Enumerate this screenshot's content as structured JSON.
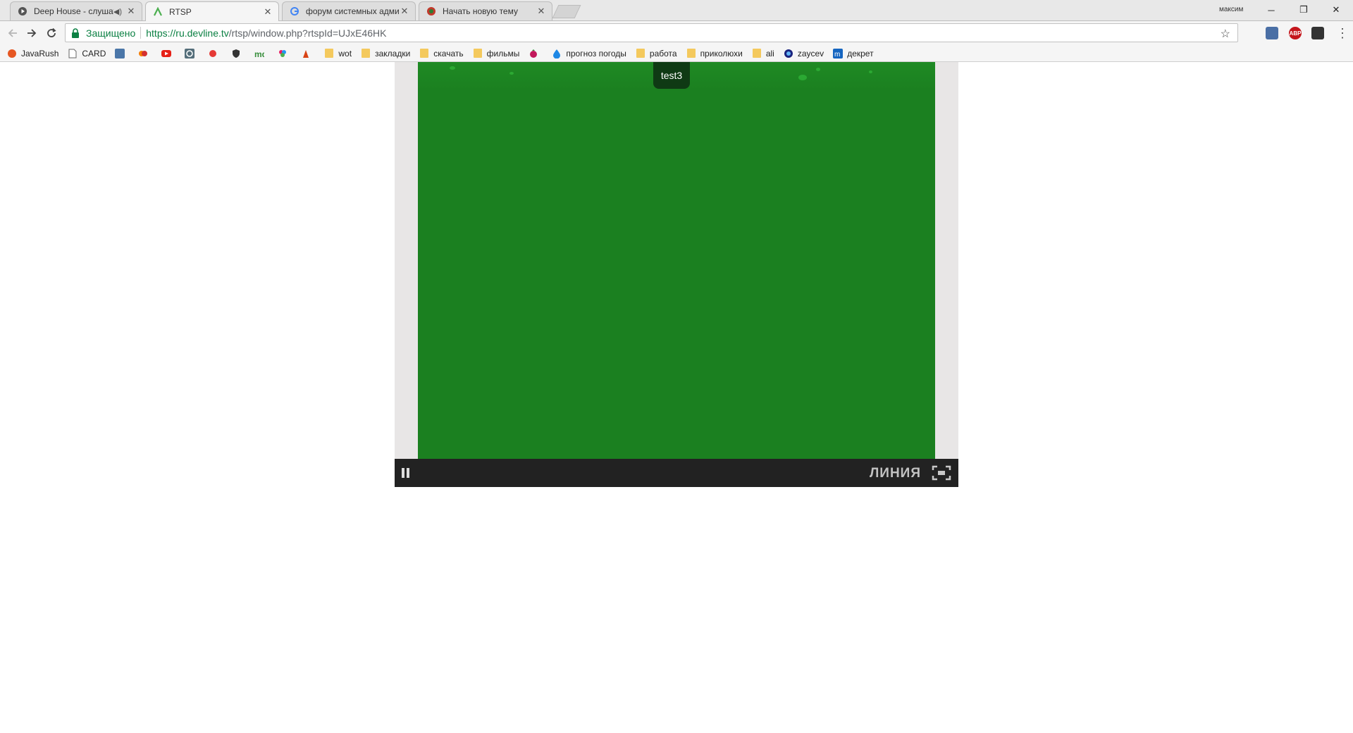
{
  "tabs": [
    {
      "title": "Deep House - слушать",
      "icon": "play-circle-icon",
      "audio": true
    },
    {
      "title": "RTSP",
      "icon": "devline-logo-icon",
      "active": true
    },
    {
      "title": "форум системных адми",
      "icon": "google-g-icon"
    },
    {
      "title": "Начать новую тему",
      "icon": "forum-logo-icon"
    }
  ],
  "profile_name": "максим",
  "window_controls": {
    "minimize": "─",
    "restore": "❐",
    "close": "✕"
  },
  "toolbar": {
    "security_label": "Защищено",
    "url_scheme": "https://",
    "url_host": "ru.devline.tv",
    "url_path": "/rtsp/window.php?rtspId=UJxE46HK",
    "extensions": [
      "shield-extension-icon",
      "adblock-icon",
      "ghostery-icon"
    ],
    "adblock_label": "ABP"
  },
  "bookmarks": [
    {
      "label": "JavaRush",
      "icon": "javarush-icon"
    },
    {
      "label": "CARD",
      "icon": "page-icon"
    },
    {
      "label": "",
      "icon": "vk-icon"
    },
    {
      "label": "",
      "icon": "site-icon-1"
    },
    {
      "label": "",
      "icon": "youtube-icon"
    },
    {
      "label": "",
      "icon": "site-icon-2"
    },
    {
      "label": "",
      "icon": "red-dot-icon"
    },
    {
      "label": "",
      "icon": "shield-icon"
    },
    {
      "label": "",
      "icon": "md-icon"
    },
    {
      "label": "",
      "icon": "colorful-icon"
    },
    {
      "label": "",
      "icon": "red-figure-icon"
    },
    {
      "label": "wot",
      "icon": "folder-icon"
    },
    {
      "label": "закладки",
      "icon": "folder-icon"
    },
    {
      "label": "скачать",
      "icon": "folder-icon"
    },
    {
      "label": "фильмы",
      "icon": "folder-icon"
    },
    {
      "label": "",
      "icon": "raspberry-icon"
    },
    {
      "label": "прогноз погоды",
      "icon": "drop-icon"
    },
    {
      "label": "работа",
      "icon": "folder-icon"
    },
    {
      "label": "приколюхи",
      "icon": "folder-icon"
    },
    {
      "label": "ali",
      "icon": "folder-icon"
    },
    {
      "label": "zaycev",
      "icon": "zaycev-icon"
    },
    {
      "label": "декрет",
      "icon": "dekret-icon"
    }
  ],
  "player": {
    "camera_label": "test3",
    "brand": "ЛИНИЯ",
    "video_color": "#1b8020"
  },
  "colors": {
    "secure_green": "#0b8043",
    "player_bar": "#222222"
  }
}
